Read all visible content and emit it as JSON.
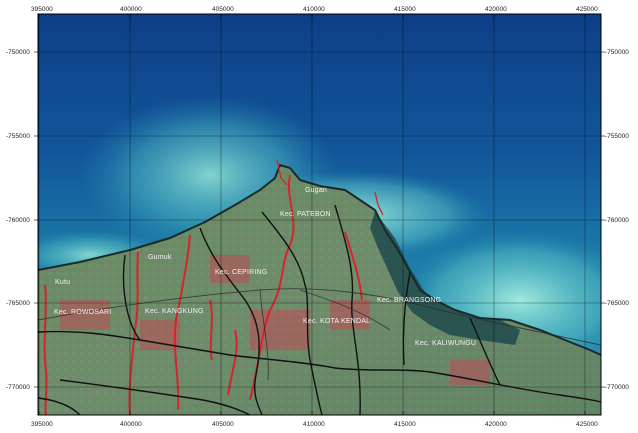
{
  "map": {
    "x_ticks": [
      "395000",
      "400000",
      "405000",
      "410000",
      "415000",
      "420000",
      "425000"
    ],
    "y_ticks": [
      "-750000",
      "-755000",
      "-760000",
      "-765000",
      "-770000"
    ],
    "labels": {
      "gumuk": "Gumuk",
      "cepiring": "Cepiring",
      "patebon": "Kec. PATEBON",
      "k_cepiring": "Kec. CEPIRING",
      "kangkung": "Kec. KANGKUNG",
      "rowosari": "Kec. ROWOSARI",
      "kota_kendal": "Kec. KOTA KENDAL",
      "brangsong": "Kec. BRANGSONG",
      "kaliwungu": "Kec. KALIWUNGU",
      "kutu": "Kutu",
      "sea_label": "Gugan"
    }
  }
}
